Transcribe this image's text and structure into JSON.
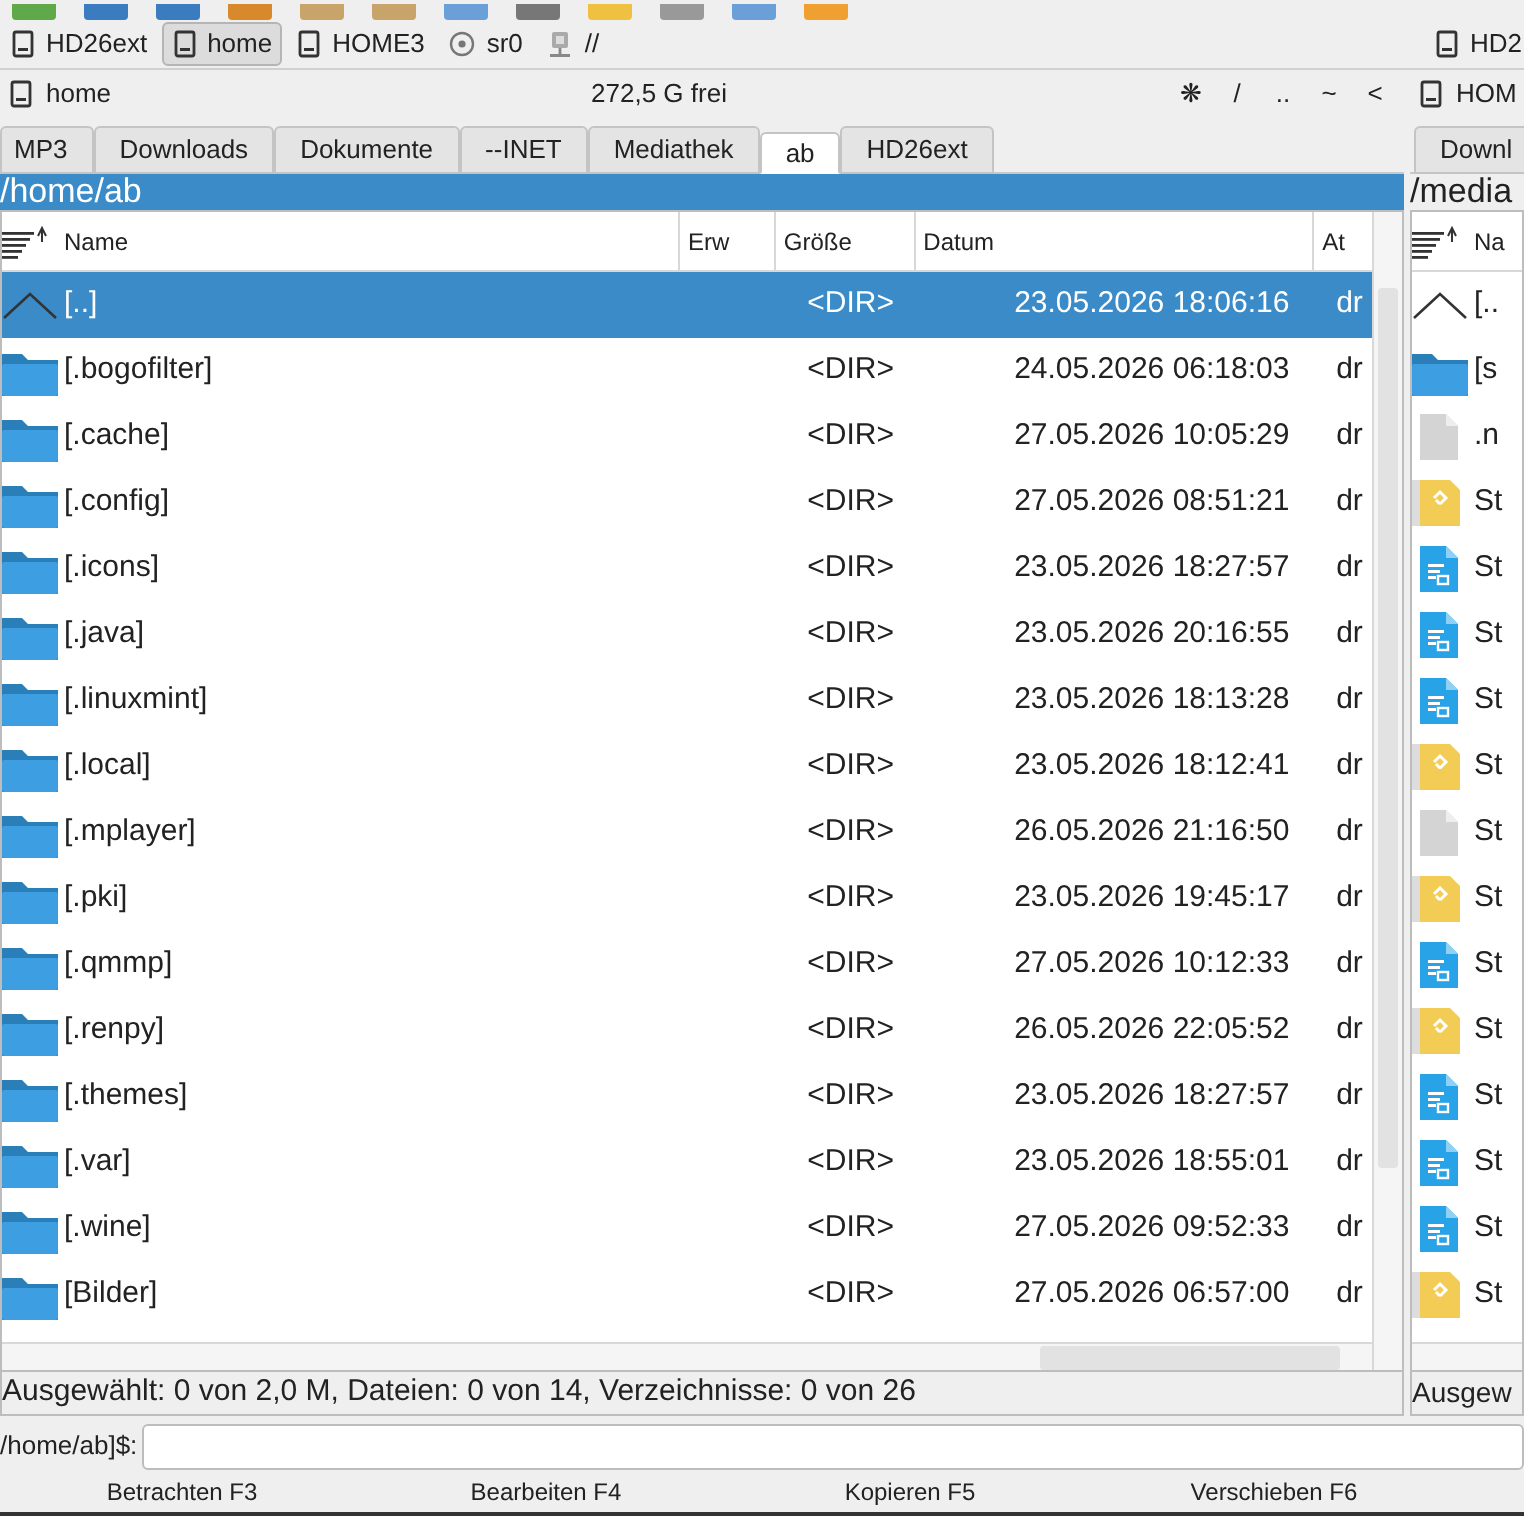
{
  "drive_bar": {
    "left": [
      {
        "label": "HD26ext",
        "selected": false,
        "kind": "drive"
      },
      {
        "label": "home",
        "selected": true,
        "kind": "drive"
      },
      {
        "label": "HOME3",
        "selected": false,
        "kind": "drive"
      },
      {
        "label": "sr0",
        "selected": false,
        "kind": "disc"
      },
      {
        "label": "//",
        "selected": false,
        "kind": "network"
      }
    ],
    "right": [
      {
        "label": "HD2",
        "selected": false,
        "kind": "drive"
      }
    ]
  },
  "left_panel": {
    "drive": "home",
    "free": "272,5 G frei",
    "nav_buttons": [
      "❋",
      "/",
      "..",
      "~",
      "<"
    ],
    "tabs": [
      {
        "label": "MP3",
        "selected": false
      },
      {
        "label": "Downloads",
        "selected": false
      },
      {
        "label": "Dokumente",
        "selected": false
      },
      {
        "label": "--INET",
        "selected": false
      },
      {
        "label": "Mediathek",
        "selected": false
      },
      {
        "label": "ab",
        "selected": true
      },
      {
        "label": "HD26ext",
        "selected": false
      }
    ],
    "path": "/home/ab",
    "columns": [
      "Name",
      "Erw",
      "Größe",
      "Datum",
      "At"
    ],
    "rows": [
      {
        "kind": "up",
        "name": "[..]",
        "size": "<DIR>",
        "date": "23.05.2026 18:06:16",
        "attr": "dr",
        "selected": true
      },
      {
        "kind": "folder",
        "name": "[.bogofilter]",
        "size": "<DIR>",
        "date": "24.05.2026 06:18:03",
        "attr": "dr",
        "selected": false
      },
      {
        "kind": "folder",
        "name": "[.cache]",
        "size": "<DIR>",
        "date": "27.05.2026 10:05:29",
        "attr": "dr",
        "selected": false
      },
      {
        "kind": "folder",
        "name": "[.config]",
        "size": "<DIR>",
        "date": "27.05.2026 08:51:21",
        "attr": "dr",
        "selected": false
      },
      {
        "kind": "folder",
        "name": "[.icons]",
        "size": "<DIR>",
        "date": "23.05.2026 18:27:57",
        "attr": "dr",
        "selected": false
      },
      {
        "kind": "folder",
        "name": "[.java]",
        "size": "<DIR>",
        "date": "23.05.2026 20:16:55",
        "attr": "dr",
        "selected": false
      },
      {
        "kind": "folder",
        "name": "[.linuxmint]",
        "size": "<DIR>",
        "date": "23.05.2026 18:13:28",
        "attr": "dr",
        "selected": false
      },
      {
        "kind": "folder",
        "name": "[.local]",
        "size": "<DIR>",
        "date": "23.05.2026 18:12:41",
        "attr": "dr",
        "selected": false
      },
      {
        "kind": "folder",
        "name": "[.mplayer]",
        "size": "<DIR>",
        "date": "26.05.2026 21:16:50",
        "attr": "dr",
        "selected": false
      },
      {
        "kind": "folder",
        "name": "[.pki]",
        "size": "<DIR>",
        "date": "23.05.2026 19:45:17",
        "attr": "dr",
        "selected": false
      },
      {
        "kind": "folder",
        "name": "[.qmmp]",
        "size": "<DIR>",
        "date": "27.05.2026 10:12:33",
        "attr": "dr",
        "selected": false
      },
      {
        "kind": "folder",
        "name": "[.renpy]",
        "size": "<DIR>",
        "date": "26.05.2026 22:05:52",
        "attr": "dr",
        "selected": false
      },
      {
        "kind": "folder",
        "name": "[.themes]",
        "size": "<DIR>",
        "date": "23.05.2026 18:27:57",
        "attr": "dr",
        "selected": false
      },
      {
        "kind": "folder",
        "name": "[.var]",
        "size": "<DIR>",
        "date": "23.05.2026 18:55:01",
        "attr": "dr",
        "selected": false
      },
      {
        "kind": "folder",
        "name": "[.wine]",
        "size": "<DIR>",
        "date": "27.05.2026 09:52:33",
        "attr": "dr",
        "selected": false
      },
      {
        "kind": "folder",
        "name": "[Bilder]",
        "size": "<DIR>",
        "date": "27.05.2026 06:57:00",
        "attr": "dr",
        "selected": false
      }
    ],
    "status": "Ausgewählt: 0 von 2,0 M, Dateien: 0 von 14, Verzeichnisse: 0 von 26"
  },
  "right_panel": {
    "drive": "HOM",
    "tabs": [
      {
        "label": "Downl",
        "selected": false
      }
    ],
    "path": "/media",
    "columns": [
      "Na"
    ],
    "rows": [
      {
        "kind": "up",
        "name": "[.."
      },
      {
        "kind": "folder",
        "name": "[s"
      },
      {
        "kind": "file",
        "name": ".n"
      },
      {
        "kind": "ebook",
        "name": "St"
      },
      {
        "kind": "doc",
        "name": "St"
      },
      {
        "kind": "doc",
        "name": "St"
      },
      {
        "kind": "doc",
        "name": "St"
      },
      {
        "kind": "ebook",
        "name": "St"
      },
      {
        "kind": "file",
        "name": "St"
      },
      {
        "kind": "ebook",
        "name": "St"
      },
      {
        "kind": "doc",
        "name": "St"
      },
      {
        "kind": "ebook",
        "name": "St"
      },
      {
        "kind": "doc",
        "name": "St"
      },
      {
        "kind": "doc",
        "name": "St"
      },
      {
        "kind": "doc",
        "name": "St"
      },
      {
        "kind": "ebook",
        "name": "St"
      }
    ],
    "status": "Ausgew"
  },
  "command_line": {
    "prompt": "/home/ab]$:"
  },
  "function_keys": [
    "Betrachten F3",
    "Bearbeiten F4",
    "Kopieren F5",
    "Verschieben F6"
  ]
}
